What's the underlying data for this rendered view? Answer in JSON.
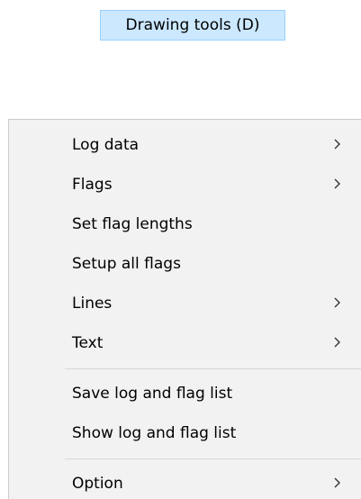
{
  "toolbar": {
    "drawing_tools_label": "Drawing tools (D)"
  },
  "menu": {
    "items": [
      {
        "label": "Log data",
        "submenu": true
      },
      {
        "label": "Flags",
        "submenu": true
      },
      {
        "label": "Set flag lengths",
        "submenu": false
      },
      {
        "label": "Setup all flags",
        "submenu": false
      },
      {
        "label": "Lines",
        "submenu": true
      },
      {
        "label": "Text",
        "submenu": true
      },
      {
        "label": "Save log and flag list",
        "submenu": false
      },
      {
        "label": "Show log and flag list",
        "submenu": false
      },
      {
        "label": "Option",
        "submenu": true
      }
    ]
  },
  "icons": {
    "submenu_arrow": "chevron-right-icon"
  },
  "colors": {
    "button_highlight": "#cce8ff",
    "button_border": "#99d1ff",
    "menu_background": "#f2f2f2",
    "separator": "#d7d7d7"
  }
}
